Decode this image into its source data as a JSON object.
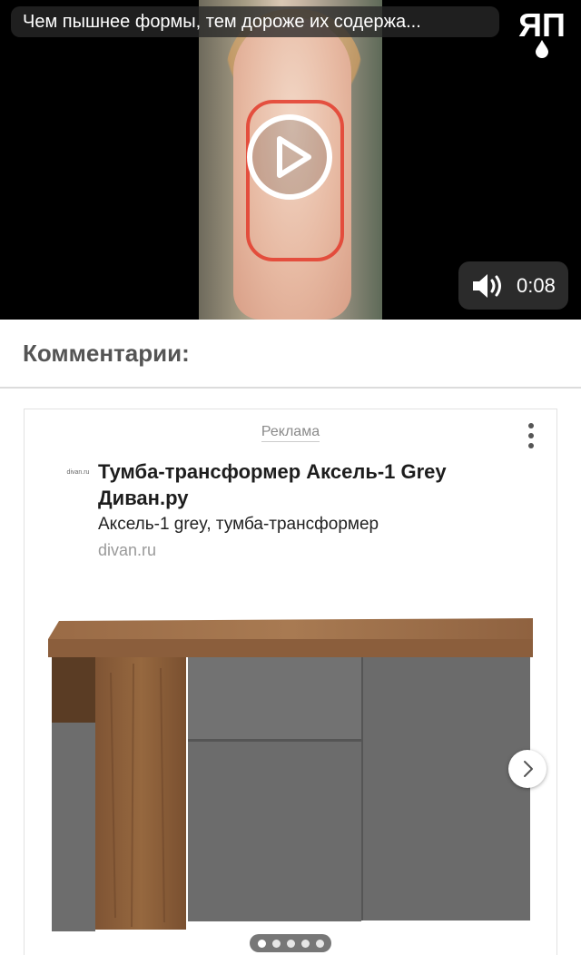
{
  "video": {
    "title": "Чем пышнее формы, тем дороже их содержа...",
    "logo_text": "ЯП",
    "duration": "0:08",
    "play_icon": "play-icon",
    "sound_icon": "speaker-icon"
  },
  "comments": {
    "heading": "Комментарии:"
  },
  "ad": {
    "label": "Реклама",
    "favicon_text": "divan.ru",
    "title": "Тумба-трансформер Аксель-1 Grey Диван.ру",
    "subtitle": "Аксель-1 grey, тумба-трансформер",
    "domain": "divan.ru",
    "carousel": {
      "total_slides": 5,
      "active_slide": 1
    }
  },
  "colors": {
    "accent_red": "#e33b2c",
    "wood": "#8b5e3c",
    "panel_grey": "#6d6d6d"
  }
}
